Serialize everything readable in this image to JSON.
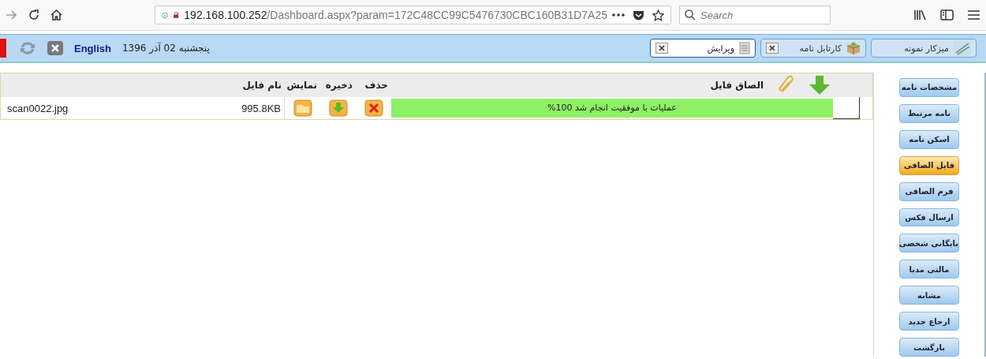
{
  "browser": {
    "url_host": "192.168.100.252",
    "url_path": "/Dashboard.aspx?param=172C48CC99C5476730CBC160B31D7A25",
    "search": {
      "placeholder": "Search"
    }
  },
  "app_bar": {
    "language_link": "English",
    "date": "پنجشنبه 02 آذر 1396",
    "tabs": [
      {
        "label": "میزکار نمونه",
        "selected": false,
        "closable": false
      },
      {
        "label": "کارتابل نامه",
        "selected": false,
        "closable": true
      },
      {
        "label": "ویرایش",
        "selected": true,
        "closable": true
      }
    ]
  },
  "attach_panel": {
    "title": "الصاق فایل",
    "columns": [
      "حذف",
      "ذخیره",
      "نمایش",
      "نام فایل"
    ],
    "rows": [
      {
        "progress": {
          "level": 1,
          "text": "عملیات با موفقیت انجام شد 100%"
        },
        "size": "995.8KB",
        "file_name": "scan0022.jpg"
      }
    ]
  },
  "sidebar": {
    "items": [
      {
        "label": "مشخصات نامه",
        "selected": false
      },
      {
        "label": "نامه مرتبط",
        "selected": false
      },
      {
        "label": "اسکن نامه",
        "selected": false
      },
      {
        "label": "فایل الصاقی",
        "selected": true
      },
      {
        "label": "فرم الصاقی",
        "selected": false
      },
      {
        "label": "ارسال فکس",
        "selected": false
      },
      {
        "label": "بایگانی شخصی",
        "selected": false
      },
      {
        "label": "مالتی مدیا",
        "selected": false
      },
      {
        "label": "مشابه",
        "selected": false
      },
      {
        "label": "ارجاع جدید",
        "selected": false
      },
      {
        "label": "بازگشت",
        "selected": false
      }
    ]
  }
}
